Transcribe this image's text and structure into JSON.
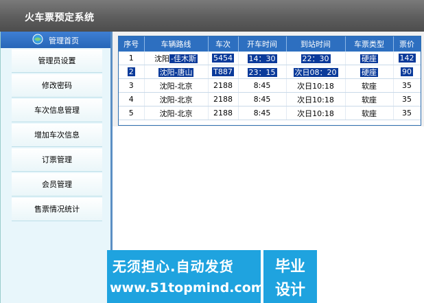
{
  "app": {
    "title": "火车票预定系统"
  },
  "sidebar": {
    "header": "管理首页",
    "items": [
      {
        "label": "管理员设置"
      },
      {
        "label": "修改密码"
      },
      {
        "label": "车次信息管理"
      },
      {
        "label": "增加车次信息"
      },
      {
        "label": "订票管理"
      },
      {
        "label": "会员管理"
      },
      {
        "label": "售票情况统计"
      }
    ]
  },
  "table": {
    "headers": [
      "序号",
      "车辆路线",
      "车次",
      "开车时间",
      "到站时间",
      "车票类型",
      "票价"
    ],
    "rows": [
      {
        "no": "1",
        "route_a": "沈阳",
        "route_b": "-佳木斯",
        "train": "5454",
        "depart": "14：30",
        "arrive": "22：30",
        "type": "硬座",
        "price": "142"
      },
      {
        "no": "2",
        "route_a": "沈阳-唐山",
        "route_b": "",
        "train": "T887",
        "depart": "23：15",
        "arrive": "次日08：20",
        "type": "硬座",
        "price": "90"
      },
      {
        "no": "3",
        "route_a": "沈阳-北京",
        "route_b": "",
        "train": "2188",
        "depart": "8:45",
        "arrive": "次日10:18",
        "type": "软座",
        "price": "35"
      },
      {
        "no": "4",
        "route_a": "沈阳-北京",
        "route_b": "",
        "train": "2188",
        "depart": "8:45",
        "arrive": "次日10:18",
        "type": "软座",
        "price": "35"
      },
      {
        "no": "5",
        "route_a": "沈阳-北京",
        "route_b": "",
        "train": "2188",
        "depart": "8:45",
        "arrive": "次日10:18",
        "type": "软座",
        "price": "35"
      }
    ]
  },
  "banner": {
    "line1": "无须担心.自动发货",
    "line2": "www.51topmind.com",
    "right1": "毕业",
    "right2": "设计"
  },
  "colors": {
    "accent": "#2d6fc0",
    "selection": "#0a3a9a",
    "banner": "#1fa3df"
  }
}
